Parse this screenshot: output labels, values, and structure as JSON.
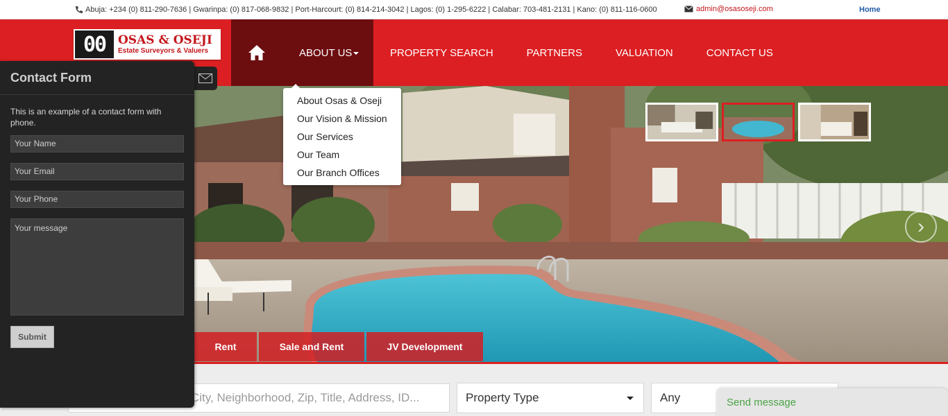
{
  "topbar": {
    "phones": "Abuja: +234 (0) 811-290-7636 | Gwarinpa: (0) 817-068-9832 | Port-Harcourt: (0) 814-214-3042 | Lagos: (0) 1-295-6222 | Calabar: 703-481-2131 | Kano: (0) 811-116-0600",
    "email": "admin@osasoseji.com",
    "home": "Home"
  },
  "logo": {
    "mark": "00",
    "name": "OSAS & OSEJI",
    "tagline": "Estate Surveyors & Valuers"
  },
  "nav": {
    "about": "ABOUT US",
    "property_search": "PROPERTY SEARCH",
    "partners": "PARTNERS",
    "valuation": "VALUATION",
    "contact": "CONTACT US"
  },
  "dropdown": {
    "items": [
      "About Osas & Oseji",
      "Our Vision & Mission",
      "Our Services",
      "Our Team",
      "Our Branch Offices"
    ]
  },
  "tabs": {
    "rent": "Rent",
    "sale_rent": "Sale and Rent",
    "jv": "JV Development"
  },
  "search": {
    "placeholder": "City, Neighborhood, Zip, Title, Address, ID...",
    "property_type": "Property Type",
    "any": "Any"
  },
  "contact_form": {
    "title": "Contact Form",
    "intro": "This is an example of a contact form with phone.",
    "name_placeholder": "Your Name",
    "email_placeholder": "Your Email",
    "phone_placeholder": "Your Phone",
    "message_placeholder": "Your message",
    "submit": "Submit"
  },
  "send_message": "Send message",
  "slider": {
    "next_arrow": "›"
  },
  "colors": {
    "brand_red": "#dc1f22",
    "nav_active": "#6c0d10",
    "panel_bg": "#232323",
    "send_green": "#4aa345"
  }
}
